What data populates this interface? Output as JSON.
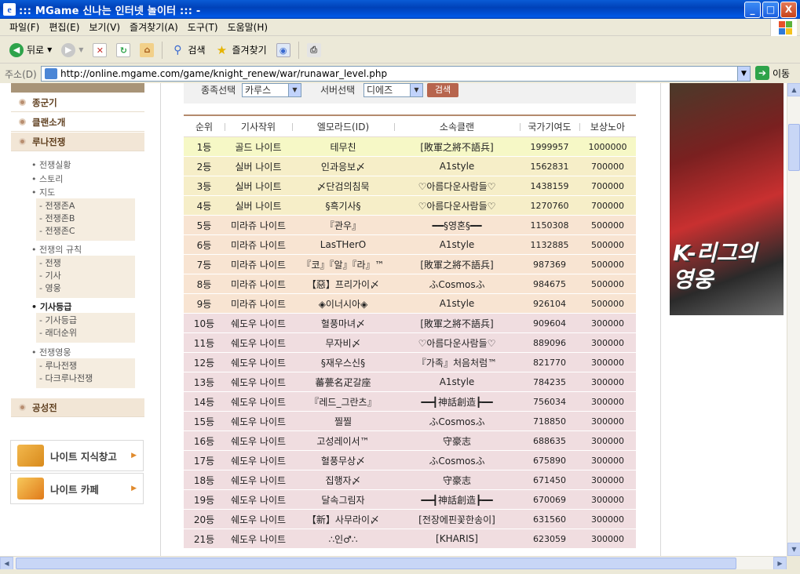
{
  "window": {
    "title": "::: MGame 신나는 인터넷 놀이터 ::: -",
    "buttons": {
      "minimize": "_",
      "maximize": "□",
      "close": "X"
    }
  },
  "menu": [
    "파일(F)",
    "편집(E)",
    "보기(V)",
    "즐겨찾기(A)",
    "도구(T)",
    "도움말(H)"
  ],
  "toolbar": {
    "back": "뒤로",
    "search": "검색",
    "favorites": "즐겨찾기"
  },
  "address": {
    "label": "주소(D)",
    "url": "http://online.mgame.com/game/knight_renew/war/runawar_level.php",
    "go": "이동"
  },
  "leftnav": {
    "sections": [
      "종군기",
      "클랜소개",
      "루나전쟁",
      "공성전"
    ],
    "war_items": [
      "전쟁실황",
      "스토리",
      "지도"
    ],
    "map_items": [
      "- 전쟁존A",
      "- 전쟁존B",
      "- 전쟁존C"
    ],
    "rules_title": "전쟁의 규칙",
    "rules_items": [
      "- 전쟁",
      "- 기사",
      "- 영웅"
    ],
    "grade_title": "기사등급",
    "grade_items": [
      "- 기사등급",
      "- 래더순위"
    ],
    "hero_title": "전쟁영웅",
    "hero_items": [
      "- 루나전쟁",
      "- 다크루나전쟁"
    ],
    "banners": [
      "나이트 지식창고",
      "나이트 카페"
    ]
  },
  "search": {
    "race_label": "종족선택",
    "race_value": "카루스",
    "server_label": "서버선택",
    "server_value": "디에즈",
    "button": "검색"
  },
  "table": {
    "headers": [
      "순위",
      "기사작위",
      "엘모라드(ID)",
      "소속클랜",
      "국가기여도",
      "보상노아"
    ],
    "rows": [
      [
        "1등",
        "골드 나이트",
        "테무친",
        "[敗軍之將不語兵]",
        "1999957",
        "1000000"
      ],
      [
        "2등",
        "실버 나이트",
        "인과응보〆",
        "A1style",
        "1562831",
        "700000"
      ],
      [
        "3등",
        "실버 나이트",
        "〆단검의침묵",
        "♡아름다운사람들♡",
        "1438159",
        "700000"
      ],
      [
        "4등",
        "실버 나이트",
        "§흑기사§",
        "♡아름다운사람들♡",
        "1270760",
        "700000"
      ],
      [
        "5등",
        "미라쥬 나이트",
        "『관우』",
        "━━§영혼§━━",
        "1150308",
        "500000"
      ],
      [
        "6등",
        "미라쥬 나이트",
        "LasTHerO",
        "A1style",
        "1132885",
        "500000"
      ],
      [
        "7등",
        "미라쥬 나이트",
        "『코』『알』『라』™",
        "[敗軍之將不語兵]",
        "987369",
        "500000"
      ],
      [
        "8등",
        "미라쥬 나이트",
        "【惡】프리가이〆",
        "ふCosmosふ",
        "984675",
        "500000"
      ],
      [
        "9등",
        "미라쥬 나이트",
        "◈이너시아◈",
        "A1style",
        "926104",
        "500000"
      ],
      [
        "10등",
        "쉐도우 나이트",
        "혈풍마녀〆",
        "[敗軍之將不語兵]",
        "909604",
        "300000"
      ],
      [
        "11등",
        "쉐도우 나이트",
        "무자비〆",
        "♡아름다운사람들♡",
        "889096",
        "300000"
      ],
      [
        "12등",
        "쉐도우 나이트",
        "§재우스신§",
        "『가족』처음처럼™",
        "821770",
        "300000"
      ],
      [
        "13등",
        "쉐도우 나이트",
        "蕃甍名疋갈座",
        "A1style",
        "784235",
        "300000"
      ],
      [
        "14등",
        "쉐도우 나이트",
        "『레드_그란츠』",
        "━━┫神話創造┣━━",
        "756034",
        "300000"
      ],
      [
        "15등",
        "쉐도우 나이트",
        "찔찔",
        "ふCosmosふ",
        "718850",
        "300000"
      ],
      [
        "16등",
        "쉐도우 나이트",
        "고성레이서™",
        "守豪志",
        "688635",
        "300000"
      ],
      [
        "17등",
        "쉐도우 나이트",
        "혈풍무상〆",
        "ふCosmosふ",
        "675890",
        "300000"
      ],
      [
        "18등",
        "쉐도우 나이트",
        "집행자〆",
        "守豪志",
        "671450",
        "300000"
      ],
      [
        "19등",
        "쉐도우 나이트",
        "달속그림자",
        "━━┫神話創造┣━━",
        "670069",
        "300000"
      ],
      [
        "20등",
        "쉐도우 나이트",
        "【新】사무라이〆",
        "[전장에핀꽃한송이]",
        "631560",
        "300000"
      ],
      [
        "21등",
        "쉐도우 나이트",
        "∴인♂∴",
        "[KHARIS]",
        "623059",
        "300000"
      ]
    ],
    "row_classes": [
      "gold",
      "silver",
      "silver",
      "silver",
      "mirage",
      "mirage",
      "mirage",
      "mirage",
      "mirage",
      "shadow",
      "shadow",
      "shadow",
      "shadow",
      "shadow",
      "shadow",
      "shadow",
      "shadow",
      "shadow",
      "shadow",
      "shadow",
      "shadow"
    ]
  },
  "ad": {
    "text": "K-리그의 영웅"
  },
  "colors": {
    "gold_row": "#f6f8c6",
    "silver_row": "#f6eec8",
    "mirage_row": "#f8e4d2",
    "shadow_row": "#f0dde0",
    "table_top_border": "#b48a6d"
  }
}
